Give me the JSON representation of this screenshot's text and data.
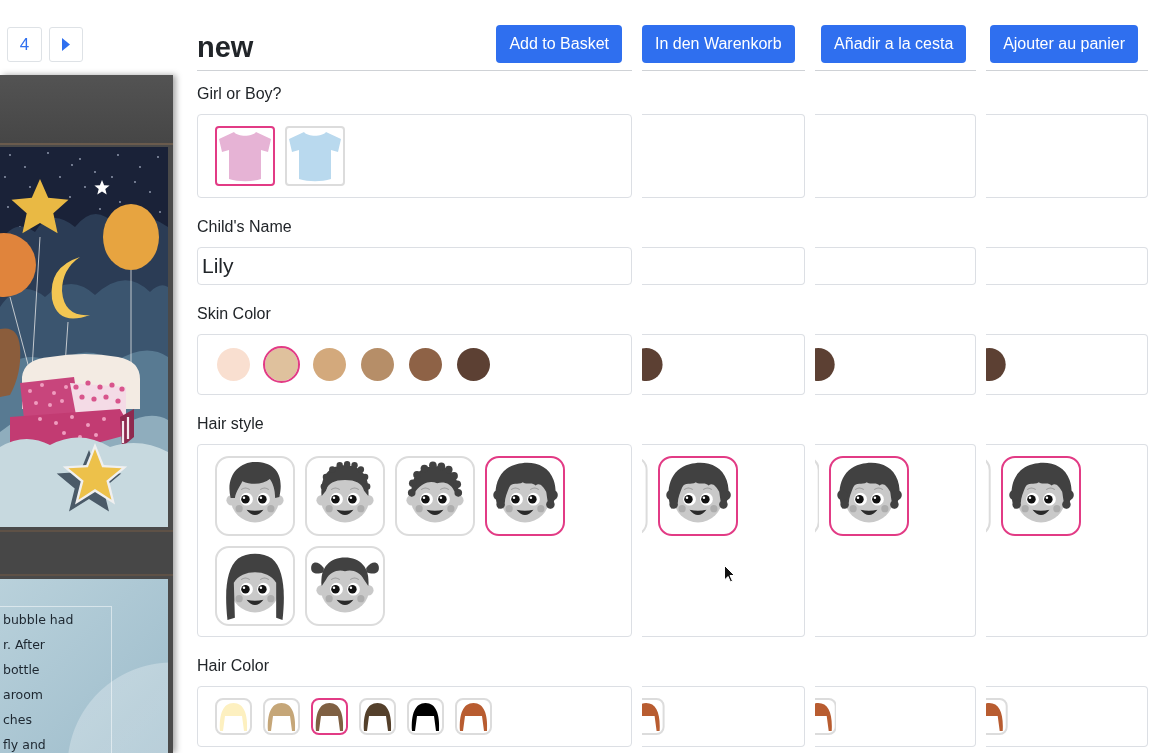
{
  "pager": {
    "page": "4"
  },
  "book_preview": {
    "page_text": [
      "bubble had",
      "r. After",
      "bottle",
      "aroom",
      "ches",
      "fly and"
    ]
  },
  "main_form": {
    "title": "new",
    "button": "Add to Basket",
    "gender": {
      "label": "Girl or Boy?",
      "options": [
        {
          "color": "#e6b3d5",
          "selected": true
        },
        {
          "color": "#b9d9ee",
          "selected": false
        }
      ]
    },
    "name": {
      "label": "Child's Name",
      "value": "Lily"
    },
    "skin_color": {
      "label": "Skin Color",
      "options": [
        {
          "color": "#f9dfd0",
          "selected": false
        },
        {
          "color": "#dfc19d",
          "selected": true
        },
        {
          "color": "#d3a97c",
          "selected": false
        },
        {
          "color": "#b68e68",
          "selected": false
        },
        {
          "color": "#8e6246",
          "selected": false
        },
        {
          "color": "#5c4033",
          "selected": false
        }
      ]
    },
    "hair_style": {
      "label": "Hair style",
      "options": [
        {
          "kind": "side_swept",
          "selected": false
        },
        {
          "kind": "short_curly",
          "selected": false
        },
        {
          "kind": "coily",
          "selected": false
        },
        {
          "kind": "wavy_bob",
          "selected": true
        },
        {
          "kind": "long_straight",
          "selected": false
        },
        {
          "kind": "pigtails",
          "selected": false
        }
      ]
    },
    "hair_color": {
      "label": "Hair Color",
      "options": [
        {
          "color": "#fdf0c0",
          "selected": false
        },
        {
          "color": "#c5a678",
          "selected": false
        },
        {
          "color": "#7f6043",
          "selected": true
        },
        {
          "color": "#54402b",
          "selected": false
        },
        {
          "color": "#000000",
          "selected": false
        },
        {
          "color": "#b85c30",
          "selected": false
        }
      ]
    }
  },
  "language_panels": [
    {
      "button": "In den Warenkorb",
      "skin_color": {
        "color": "#5c4033",
        "selected": false
      },
      "hair_style": {
        "kind": "wavy_bob",
        "selected": true
      },
      "hair_color": {
        "color": "#b85c30",
        "selected": false
      }
    },
    {
      "button": "Añadir a la cesta",
      "skin_color": {
        "color": "#5c4033",
        "selected": false
      },
      "hair_style": {
        "kind": "wavy_bob",
        "selected": true
      },
      "hair_color": {
        "color": "#b85c30",
        "selected": false
      }
    },
    {
      "button": "Ajouter au panier",
      "skin_color": {
        "color": "#5c4033",
        "selected": false
      },
      "hair_style": {
        "kind": "wavy_bob",
        "selected": true
      },
      "hair_color": {
        "color": "#b85c30",
        "selected": false
      }
    }
  ]
}
